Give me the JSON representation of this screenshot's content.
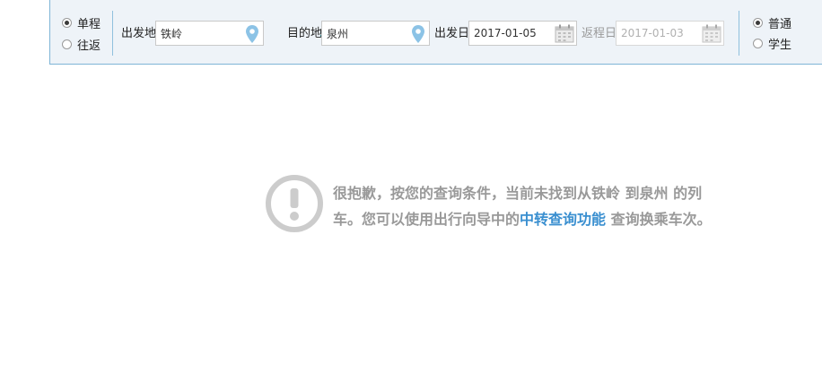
{
  "trip_type": {
    "options": [
      {
        "label": "单程",
        "checked": true
      },
      {
        "label": "往返",
        "checked": false
      }
    ]
  },
  "from": {
    "label": "出发地",
    "value": "铁岭",
    "icon": "map-pin-icon"
  },
  "swap_icon": "swap-arrows-icon",
  "to": {
    "label": "目的地",
    "value": "泉州",
    "icon": "map-pin-icon"
  },
  "depart_date": {
    "label": "出发日",
    "value": "2017-01-05",
    "icon": "calendar-icon"
  },
  "return_date": {
    "label": "返程日",
    "value": "2017-01-03",
    "icon": "calendar-icon",
    "disabled": true
  },
  "passenger_type": {
    "options": [
      {
        "label": "普通",
        "checked": true
      },
      {
        "label": "学生",
        "checked": false
      }
    ]
  },
  "message": {
    "icon": "exclamation-circle-icon",
    "text_before": "很抱歉，按您的查询条件，当前未找到从铁岭 到泉州 的列车。您可以使用出行向导中的",
    "link_text": "中转查询功能",
    "text_after": " 查询换乘车次。"
  },
  "colors": {
    "accent": "#3a8fd0",
    "bar_bg": "#eef3f8",
    "border": "#7fb5d6",
    "pin": "#8cc3e6",
    "swap": "#1aa0a8",
    "message_text": "#999999",
    "warn_icon": "#cccccc"
  }
}
